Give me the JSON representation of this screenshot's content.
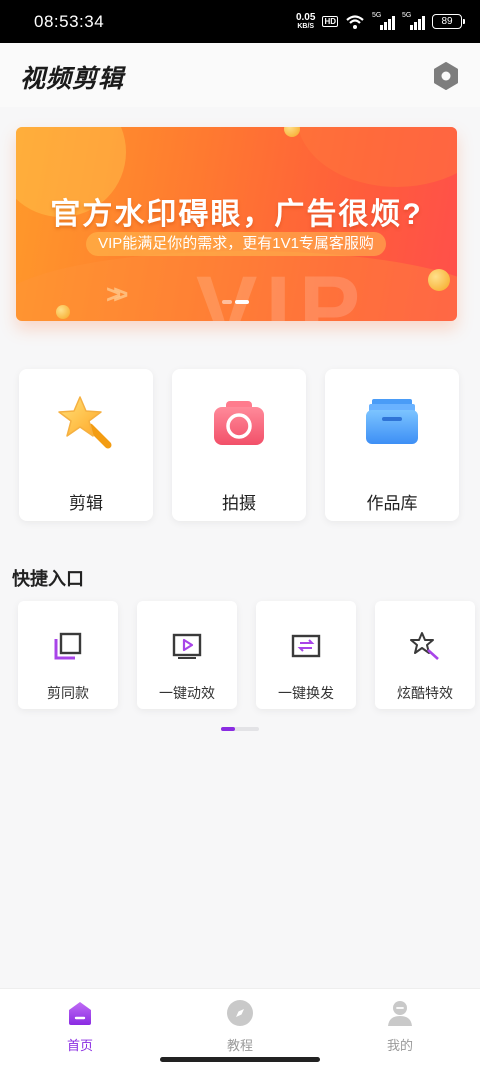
{
  "status_bar": {
    "time": "08:53:34",
    "net_speed_value": "0.05",
    "net_speed_unit": "KB/S",
    "hd_label": "HD",
    "signal_labels": [
      "5G",
      "5G"
    ],
    "battery": "89"
  },
  "header": {
    "app_title": "视频剪辑",
    "settings_icon": "hexagon-settings-icon"
  },
  "banner": {
    "headline": "官方水印碍眼，广告很烦?",
    "subtext": "VIP能满足你的需求，更有1V1专属客服购",
    "background_text": "VIP",
    "page_count": 2,
    "active_page": 1,
    "colors": {
      "start": "#ff9a2a",
      "end": "#ff4f4b"
    }
  },
  "main_actions": [
    {
      "label": "剪辑",
      "icon": "star-wand-icon"
    },
    {
      "label": "拍摄",
      "icon": "camera-icon"
    },
    {
      "label": "作品库",
      "icon": "folder-icon"
    }
  ],
  "quick_section": {
    "title": "快捷入口",
    "items": [
      {
        "label": "剪同款",
        "icon": "copy-layers-icon"
      },
      {
        "label": "一键动效",
        "icon": "play-box-icon"
      },
      {
        "label": "一键换发",
        "icon": "swap-box-icon"
      },
      {
        "label": "炫酷特效",
        "icon": "sparkle-cursor-icon"
      }
    ],
    "page_indicator_progress": 0.37
  },
  "bottom_nav": {
    "items": [
      {
        "label": "首页",
        "icon": "home-icon",
        "active": true
      },
      {
        "label": "教程",
        "icon": "compass-icon",
        "active": false
      },
      {
        "label": "我的",
        "icon": "user-icon",
        "active": false
      }
    ],
    "accent_color": "#8a2be2"
  }
}
